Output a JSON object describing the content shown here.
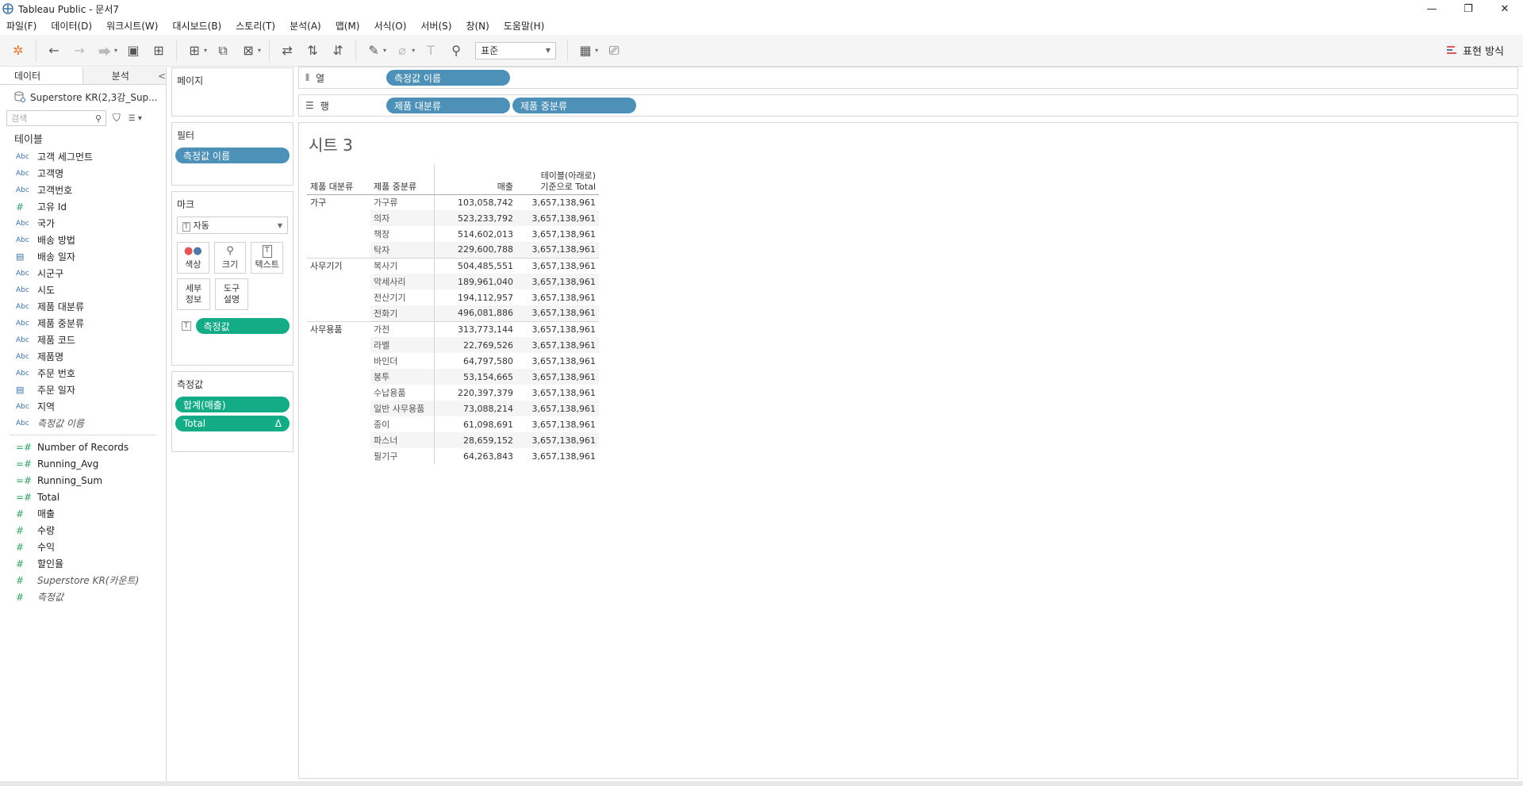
{
  "window": {
    "title": "Tableau Public - 문서7",
    "minimize": "—",
    "restore": "❐",
    "close": "✕"
  },
  "menu": [
    "파일(F)",
    "데이터(D)",
    "워크시트(W)",
    "대시보드(B)",
    "스토리(T)",
    "분석(A)",
    "맵(M)",
    "서식(O)",
    "서버(S)",
    "창(N)",
    "도움말(H)"
  ],
  "toolbar": {
    "fit_select": "표준",
    "show_me": "표현 방식"
  },
  "left_pane": {
    "tab_data": "데이터",
    "tab_analysis": "분석",
    "collapse": "<",
    "datasource": "Superstore KR(2,3강_Sup...",
    "search_placeholder": "검색",
    "tables_heading": "테이블",
    "dimensions": [
      {
        "type": "Abc",
        "name": "고객 세그먼트"
      },
      {
        "type": "Abc",
        "name": "고객명"
      },
      {
        "type": "Abc",
        "name": "고객번호"
      },
      {
        "type": "#",
        "name": "고유 Id"
      },
      {
        "type": "Abc",
        "name": "국가"
      },
      {
        "type": "Abc",
        "name": "배송 방법"
      },
      {
        "type": "date",
        "name": "배송 일자"
      },
      {
        "type": "Abc",
        "name": "시군구"
      },
      {
        "type": "Abc",
        "name": "시도"
      },
      {
        "type": "Abc",
        "name": "제품 대분류"
      },
      {
        "type": "Abc",
        "name": "제품 중분류"
      },
      {
        "type": "Abc",
        "name": "제품 코드"
      },
      {
        "type": "Abc",
        "name": "제품명"
      },
      {
        "type": "Abc",
        "name": "주문 번호"
      },
      {
        "type": "date",
        "name": "주문 일자"
      },
      {
        "type": "Abc",
        "name": "지역"
      },
      {
        "type": "Abc",
        "name": "측정값 이름",
        "italic": true
      }
    ],
    "measures": [
      {
        "type": "=#",
        "name": "Number of Records"
      },
      {
        "type": "=#",
        "name": "Running_Avg"
      },
      {
        "type": "=#",
        "name": "Running_Sum"
      },
      {
        "type": "=#",
        "name": "Total"
      },
      {
        "type": "#",
        "name": "매출"
      },
      {
        "type": "#",
        "name": "수량"
      },
      {
        "type": "#",
        "name": "수익"
      },
      {
        "type": "#",
        "name": "할인율"
      },
      {
        "type": "#",
        "name": "Superstore KR(카운트)",
        "italic": true
      },
      {
        "type": "#",
        "name": "측정값",
        "italic": true
      }
    ]
  },
  "cards": {
    "pages": "페이지",
    "filters": "필터",
    "filter_pill": "측정값 이름",
    "marks": "마크",
    "mark_type": "자동",
    "mark_buttons": [
      "색상",
      "크기",
      "텍스트"
    ],
    "mark_buttons2": [
      "세부\n정보",
      "도구\n설명"
    ],
    "mark_pill": "측정값",
    "measure_values": "측정값",
    "mv_pills": [
      {
        "name": "합계(매출)",
        "delta": ""
      },
      {
        "name": "Total",
        "delta": "Δ"
      }
    ]
  },
  "shelves": {
    "columns_label": "열",
    "columns_pills": [
      "측정값 이름"
    ],
    "rows_label": "행",
    "rows_pills": [
      "제품 대분류",
      "제품 중분류"
    ]
  },
  "sheet": {
    "title": "시트 3",
    "headers": [
      "제품 대분류",
      "제품 중분류",
      "매출",
      "테이블(아래로)\n기준으로 Total"
    ],
    "groups": [
      {
        "name": "가구",
        "rows": [
          [
            "가구류",
            "103,058,742",
            "3,657,138,961"
          ],
          [
            "의자",
            "523,233,792",
            "3,657,138,961"
          ],
          [
            "책장",
            "514,602,013",
            "3,657,138,961"
          ],
          [
            "탁자",
            "229,600,788",
            "3,657,138,961"
          ]
        ]
      },
      {
        "name": "사무기기",
        "rows": [
          [
            "복사기",
            "504,485,551",
            "3,657,138,961"
          ],
          [
            "악세사리",
            "189,961,040",
            "3,657,138,961"
          ],
          [
            "전산기기",
            "194,112,957",
            "3,657,138,961"
          ],
          [
            "전화기",
            "496,081,886",
            "3,657,138,961"
          ]
        ]
      },
      {
        "name": "사무용품",
        "rows": [
          [
            "가전",
            "313,773,144",
            "3,657,138,961"
          ],
          [
            "라벨",
            "22,769,526",
            "3,657,138,961"
          ],
          [
            "바인더",
            "64,797,580",
            "3,657,138,961"
          ],
          [
            "봉투",
            "53,154,665",
            "3,657,138,961"
          ],
          [
            "수납용품",
            "220,397,379",
            "3,657,138,961"
          ],
          [
            "일반 사무용품",
            "73,088,214",
            "3,657,138,961"
          ],
          [
            "종이",
            "61,098,691",
            "3,657,138,961"
          ],
          [
            "파스너",
            "28,659,152",
            "3,657,138,961"
          ],
          [
            "필기구",
            "64,263,843",
            "3,657,138,961"
          ]
        ]
      }
    ]
  }
}
